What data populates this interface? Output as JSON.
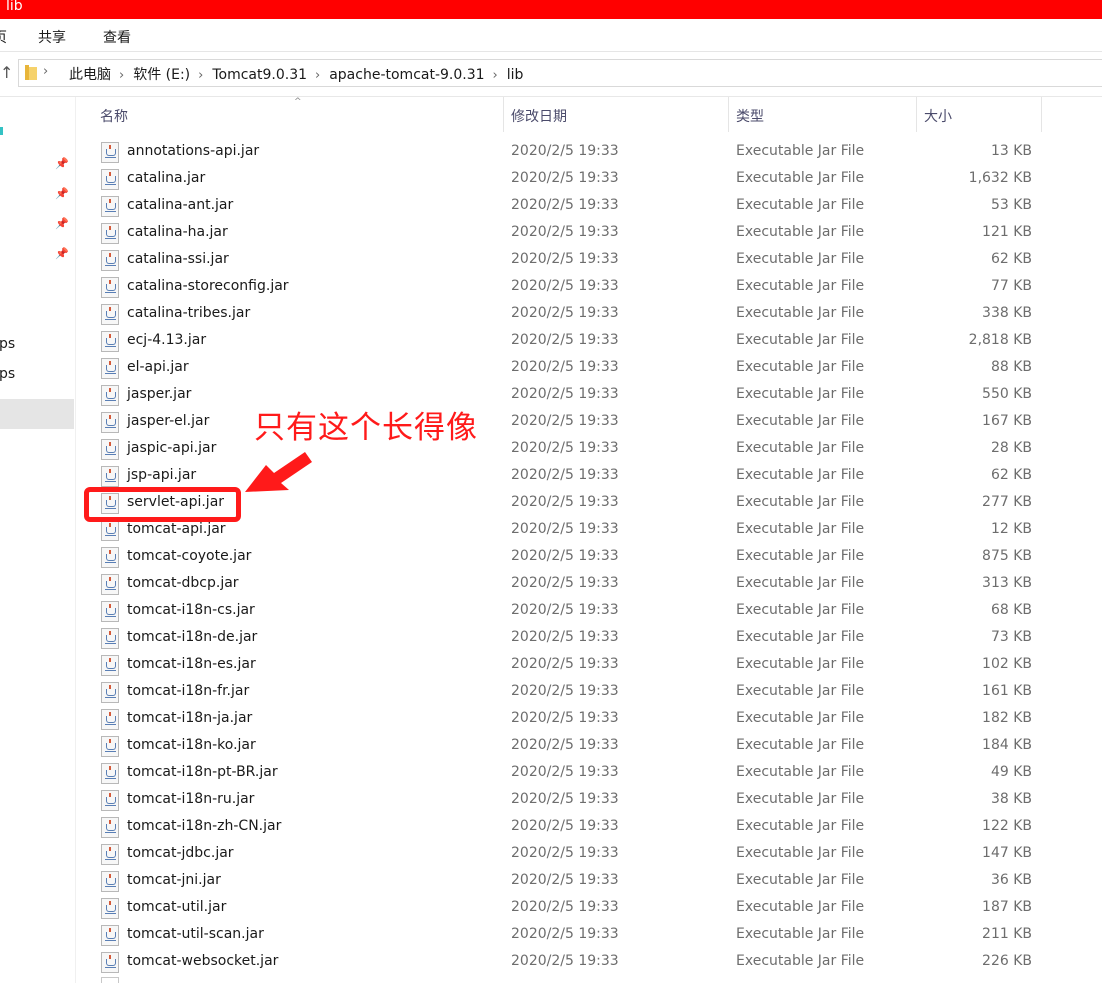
{
  "window": {
    "title": "lib",
    "accent": "#ff0000"
  },
  "ribbon": {
    "tabs": [
      "页",
      "共享",
      "查看"
    ]
  },
  "address": {
    "up_icon": "up-arrow-icon",
    "folder_icon": "folder-icon",
    "crumbs": [
      "此电脑",
      "软件 (E:)",
      "Tomcat9.0.31",
      "apache-tomcat-9.0.31",
      "lib"
    ]
  },
  "nav": {
    "items": [
      "ps",
      "ps"
    ],
    "pin_icon": "pin-icon"
  },
  "columns": {
    "name": "名称",
    "date": "修改日期",
    "type": "类型",
    "size": "大小"
  },
  "files": [
    {
      "name": "annotations-api.jar",
      "date": "2020/2/5 19:33",
      "type": "Executable Jar File",
      "size": "13 KB"
    },
    {
      "name": "catalina.jar",
      "date": "2020/2/5 19:33",
      "type": "Executable Jar File",
      "size": "1,632 KB"
    },
    {
      "name": "catalina-ant.jar",
      "date": "2020/2/5 19:33",
      "type": "Executable Jar File",
      "size": "53 KB"
    },
    {
      "name": "catalina-ha.jar",
      "date": "2020/2/5 19:33",
      "type": "Executable Jar File",
      "size": "121 KB"
    },
    {
      "name": "catalina-ssi.jar",
      "date": "2020/2/5 19:33",
      "type": "Executable Jar File",
      "size": "62 KB"
    },
    {
      "name": "catalina-storeconfig.jar",
      "date": "2020/2/5 19:33",
      "type": "Executable Jar File",
      "size": "77 KB"
    },
    {
      "name": "catalina-tribes.jar",
      "date": "2020/2/5 19:33",
      "type": "Executable Jar File",
      "size": "338 KB"
    },
    {
      "name": "ecj-4.13.jar",
      "date": "2020/2/5 19:33",
      "type": "Executable Jar File",
      "size": "2,818 KB"
    },
    {
      "name": "el-api.jar",
      "date": "2020/2/5 19:33",
      "type": "Executable Jar File",
      "size": "88 KB"
    },
    {
      "name": "jasper.jar",
      "date": "2020/2/5 19:33",
      "type": "Executable Jar File",
      "size": "550 KB"
    },
    {
      "name": "jasper-el.jar",
      "date": "2020/2/5 19:33",
      "type": "Executable Jar File",
      "size": "167 KB"
    },
    {
      "name": "jaspic-api.jar",
      "date": "2020/2/5 19:33",
      "type": "Executable Jar File",
      "size": "28 KB"
    },
    {
      "name": "jsp-api.jar",
      "date": "2020/2/5 19:33",
      "type": "Executable Jar File",
      "size": "62 KB"
    },
    {
      "name": "servlet-api.jar",
      "date": "2020/2/5 19:33",
      "type": "Executable Jar File",
      "size": "277 KB"
    },
    {
      "name": "tomcat-api.jar",
      "date": "2020/2/5 19:33",
      "type": "Executable Jar File",
      "size": "12 KB"
    },
    {
      "name": "tomcat-coyote.jar",
      "date": "2020/2/5 19:33",
      "type": "Executable Jar File",
      "size": "875 KB"
    },
    {
      "name": "tomcat-dbcp.jar",
      "date": "2020/2/5 19:33",
      "type": "Executable Jar File",
      "size": "313 KB"
    },
    {
      "name": "tomcat-i18n-cs.jar",
      "date": "2020/2/5 19:33",
      "type": "Executable Jar File",
      "size": "68 KB"
    },
    {
      "name": "tomcat-i18n-de.jar",
      "date": "2020/2/5 19:33",
      "type": "Executable Jar File",
      "size": "73 KB"
    },
    {
      "name": "tomcat-i18n-es.jar",
      "date": "2020/2/5 19:33",
      "type": "Executable Jar File",
      "size": "102 KB"
    },
    {
      "name": "tomcat-i18n-fr.jar",
      "date": "2020/2/5 19:33",
      "type": "Executable Jar File",
      "size": "161 KB"
    },
    {
      "name": "tomcat-i18n-ja.jar",
      "date": "2020/2/5 19:33",
      "type": "Executable Jar File",
      "size": "182 KB"
    },
    {
      "name": "tomcat-i18n-ko.jar",
      "date": "2020/2/5 19:33",
      "type": "Executable Jar File",
      "size": "184 KB"
    },
    {
      "name": "tomcat-i18n-pt-BR.jar",
      "date": "2020/2/5 19:33",
      "type": "Executable Jar File",
      "size": "49 KB"
    },
    {
      "name": "tomcat-i18n-ru.jar",
      "date": "2020/2/5 19:33",
      "type": "Executable Jar File",
      "size": "38 KB"
    },
    {
      "name": "tomcat-i18n-zh-CN.jar",
      "date": "2020/2/5 19:33",
      "type": "Executable Jar File",
      "size": "122 KB"
    },
    {
      "name": "tomcat-jdbc.jar",
      "date": "2020/2/5 19:33",
      "type": "Executable Jar File",
      "size": "147 KB"
    },
    {
      "name": "tomcat-jni.jar",
      "date": "2020/2/5 19:33",
      "type": "Executable Jar File",
      "size": "36 KB"
    },
    {
      "name": "tomcat-util.jar",
      "date": "2020/2/5 19:33",
      "type": "Executable Jar File",
      "size": "187 KB"
    },
    {
      "name": "tomcat-util-scan.jar",
      "date": "2020/2/5 19:33",
      "type": "Executable Jar File",
      "size": "211 KB"
    },
    {
      "name": "tomcat-websocket.jar",
      "date": "2020/2/5 19:33",
      "type": "Executable Jar File",
      "size": "226 KB"
    }
  ],
  "file_icon": "java-jar-icon",
  "annotation": {
    "text": "只有这个长得像",
    "color": "#ff1a1a"
  }
}
